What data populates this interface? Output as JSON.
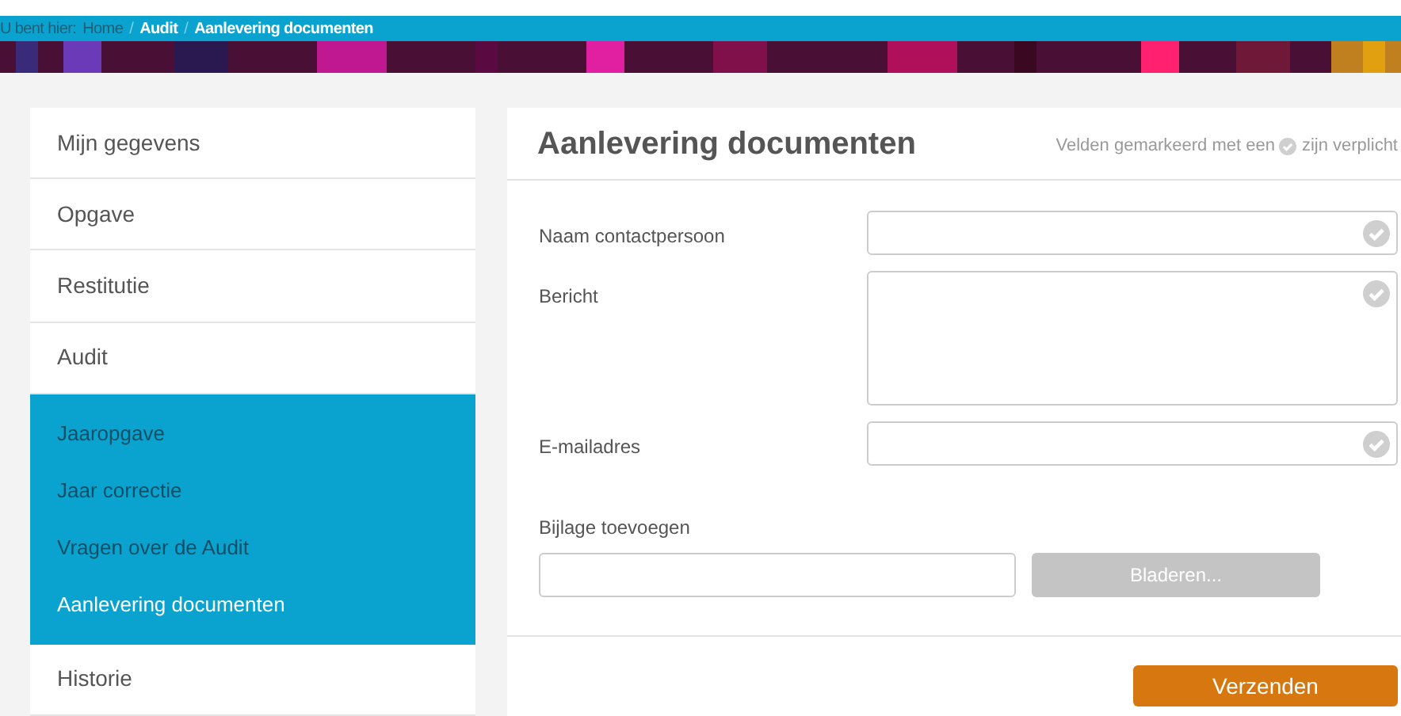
{
  "breadcrumb": {
    "prefix": "U bent hier:",
    "items": [
      {
        "label": "Home",
        "current": false
      },
      {
        "label": "Audit",
        "current": true
      },
      {
        "label": "Aanlevering documenten",
        "current": true
      }
    ],
    "separator": "/"
  },
  "sidebar": {
    "items": [
      {
        "label": "Mijn gegevens",
        "selected": false
      },
      {
        "label": "Opgave",
        "selected": false
      },
      {
        "label": "Restitutie",
        "selected": false
      },
      {
        "label": "Audit",
        "selected": false,
        "children": [
          {
            "label": "Jaaropgave",
            "selected": false
          },
          {
            "label": "Jaar correctie",
            "selected": false
          },
          {
            "label": "Vragen over de Audit",
            "selected": false
          },
          {
            "label": "Aanlevering documenten",
            "selected": true
          }
        ]
      },
      {
        "label": "Historie",
        "selected": false
      }
    ]
  },
  "form": {
    "title": "Aanlevering documenten",
    "required_note": {
      "before": "Velden gemarkeerd met een",
      "after": "zijn verplicht"
    },
    "fields": [
      {
        "label": "Naam contactpersoon",
        "kind": "text",
        "required": true
      },
      {
        "label": "Bericht",
        "kind": "textarea",
        "required": true
      },
      {
        "label": "E-mailadres",
        "kind": "text",
        "required": true
      }
    ],
    "attachment": {
      "label": "Bijlage toevoegen",
      "button": "Bladeren..."
    },
    "submit": "Verzenden"
  }
}
